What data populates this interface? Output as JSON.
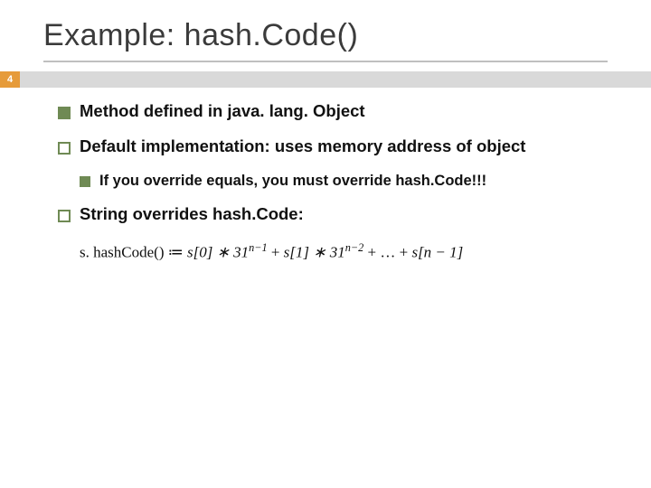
{
  "slide": {
    "title": "Example: hash.Code()",
    "page_number": "4",
    "bullets": {
      "b1": "Method defined in java. lang. Object",
      "b2": "Default implementation: uses memory address of object",
      "b2a": "If you override equals, you must override hash.Code!!!",
      "b3": "String overrides hash.Code:"
    },
    "formula": {
      "lhs": "s. hashCode() ≔ ",
      "term1_a": "s[0] ∗ 31",
      "term1_exp": "n−1",
      "plus1": " + ",
      "term2_a": "s[1] ∗ 31",
      "term2_exp": "n−2",
      "plus2": " + … + ",
      "last": "s[n − 1]"
    }
  }
}
